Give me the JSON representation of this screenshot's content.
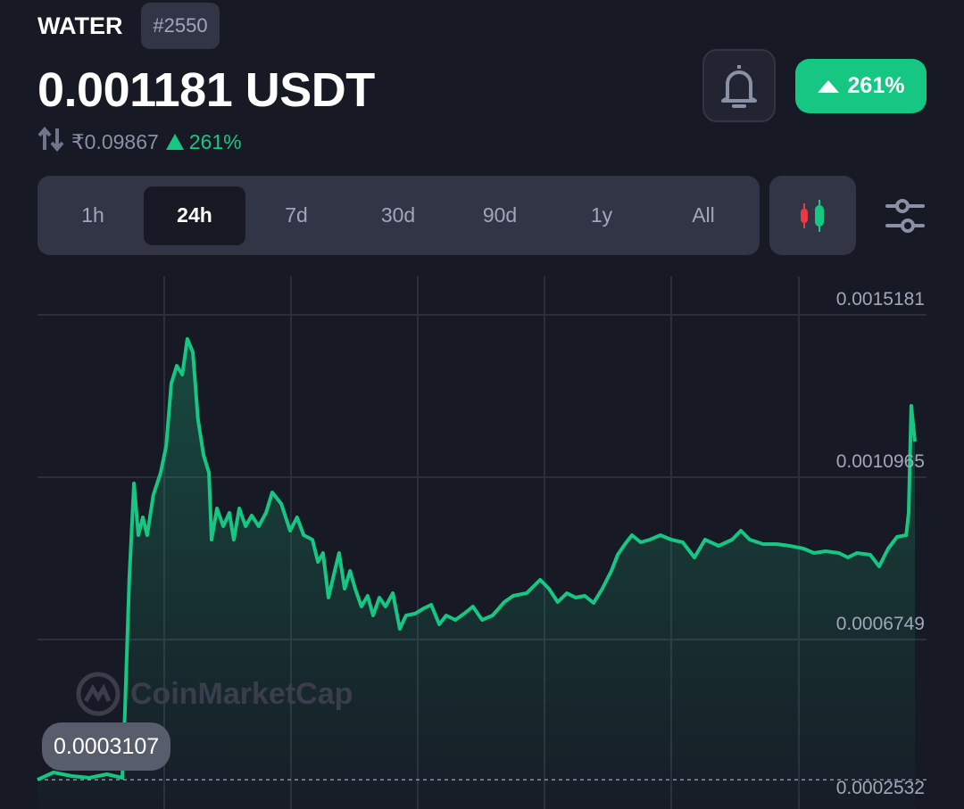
{
  "header": {
    "symbol": "WATER",
    "rank": "#2550",
    "price": "0.001181 USDT",
    "inr_price": "₹0.09867",
    "change": "261%",
    "badge_change": "261%"
  },
  "colors": {
    "up": "#16c784",
    "down": "#ea3943",
    "background": "#171924",
    "panel": "#323546"
  },
  "icons": {
    "swap": "swap-vertical-icon",
    "bell": "bell-icon",
    "candles": "candlestick-icon",
    "filter": "sliders-icon",
    "up": "triangle-up-icon"
  },
  "tabs": [
    {
      "label": "1h"
    },
    {
      "label": "24h",
      "active": true
    },
    {
      "label": "7d"
    },
    {
      "label": "30d"
    },
    {
      "label": "90d"
    },
    {
      "label": "1y"
    },
    {
      "label": "All"
    }
  ],
  "watermark": "CoinMarketCap",
  "chart_data": {
    "type": "area",
    "range": "24h",
    "grid": true,
    "y_ticks": [
      "0.0015181",
      "0.0010965",
      "0.0006749",
      "0.0002532"
    ],
    "open_price_label": "0.0003107",
    "open_price": 0.0003107,
    "xlim": [
      0,
      24
    ],
    "x_unit": "hours",
    "points": [
      [
        0,
        0.0003107
      ],
      [
        0.44,
        0.0003297
      ],
      [
        0.93,
        0.0003205
      ],
      [
        1.42,
        0.0003158
      ],
      [
        1.9,
        0.0003251
      ],
      [
        2.32,
        0.0003158
      ],
      [
        2.39,
        0.0004826
      ],
      [
        2.51,
        0.0008301
      ],
      [
        2.64,
        0.0010803
      ],
      [
        2.76,
        0.0009459
      ],
      [
        2.88,
        0.0009923
      ],
      [
        3.0,
        0.0009459
      ],
      [
        3.17,
        0.0010502
      ],
      [
        3.37,
        0.0011081
      ],
      [
        3.52,
        0.0011776
      ],
      [
        3.66,
        0.0013397
      ],
      [
        3.81,
        0.0013861
      ],
      [
        3.96,
        0.0013629
      ],
      [
        4.1,
        0.0014556
      ],
      [
        4.25,
        0.0014208
      ],
      [
        4.39,
        0.0012471
      ],
      [
        4.54,
        0.0011544
      ],
      [
        4.69,
        0.0011081
      ],
      [
        4.76,
        0.0009343
      ],
      [
        4.91,
        0.0010154
      ],
      [
        5.08,
        0.0009691
      ],
      [
        5.25,
        0.0010038
      ],
      [
        5.37,
        0.0009343
      ],
      [
        5.52,
        0.0010154
      ],
      [
        5.69,
        0.0009691
      ],
      [
        5.86,
        0.0009969
      ],
      [
        6.05,
        0.0009691
      ],
      [
        6.25,
        0.0010038
      ],
      [
        6.42,
        0.0010571
      ],
      [
        6.67,
        0.001027
      ],
      [
        6.91,
        0.0009575
      ],
      [
        7.1,
        0.0009923
      ],
      [
        7.28,
        0.0009459
      ],
      [
        7.52,
        0.0009343
      ],
      [
        7.67,
        0.0008764
      ],
      [
        7.81,
        0.0008996
      ],
      [
        7.96,
        0.0007838
      ],
      [
        8.13,
        0.0008533
      ],
      [
        8.25,
        0.0008996
      ],
      [
        8.4,
        0.0008069
      ],
      [
        8.55,
        0.0008533
      ],
      [
        8.69,
        0.0008069
      ],
      [
        8.86,
        0.0007606
      ],
      [
        9.03,
        0.0007884
      ],
      [
        9.18,
        0.0007374
      ],
      [
        9.35,
        0.0007838
      ],
      [
        9.52,
        0.0007606
      ],
      [
        9.72,
        0.0007954
      ],
      [
        9.91,
        0.0007027
      ],
      [
        10.08,
        0.0007374
      ],
      [
        10.33,
        0.0007421
      ],
      [
        10.57,
        0.000756
      ],
      [
        10.77,
        0.0007652
      ],
      [
        10.99,
        0.0007143
      ],
      [
        11.18,
        0.0007374
      ],
      [
        11.43,
        0.0007259
      ],
      [
        11.67,
        0.0007421
      ],
      [
        11.91,
        0.0007606
      ],
      [
        12.16,
        0.0007259
      ],
      [
        12.45,
        0.0007374
      ],
      [
        12.77,
        0.0007722
      ],
      [
        13.01,
        0.0007884
      ],
      [
        13.38,
        0.0007954
      ],
      [
        13.75,
        0.0008301
      ],
      [
        13.99,
        0.0008069
      ],
      [
        14.23,
        0.0007722
      ],
      [
        14.48,
        0.0007954
      ],
      [
        14.72,
        0.0007838
      ],
      [
        14.97,
        0.0007884
      ],
      [
        15.21,
        0.0007699
      ],
      [
        15.45,
        0.0008069
      ],
      [
        15.7,
        0.0008533
      ],
      [
        15.87,
        0.000895
      ],
      [
        16.07,
        0.0009228
      ],
      [
        16.26,
        0.0009459
      ],
      [
        16.5,
        0.0009274
      ],
      [
        16.75,
        0.0009343
      ],
      [
        17.04,
        0.0009459
      ],
      [
        17.33,
        0.0009343
      ],
      [
        17.65,
        0.0009274
      ],
      [
        17.97,
        0.000888
      ],
      [
        18.26,
        0.0009343
      ],
      [
        18.63,
        0.0009181
      ],
      [
        19.0,
        0.0009343
      ],
      [
        19.24,
        0.0009575
      ],
      [
        19.48,
        0.0009343
      ],
      [
        19.85,
        0.0009228
      ],
      [
        20.22,
        0.0009228
      ],
      [
        20.58,
        0.0009181
      ],
      [
        20.95,
        0.0009112
      ],
      [
        21.24,
        0.0008996
      ],
      [
        21.56,
        0.0009042
      ],
      [
        21.92,
        0.0008996
      ],
      [
        22.17,
        0.000888
      ],
      [
        22.41,
        0.0008996
      ],
      [
        22.78,
        0.000895
      ],
      [
        23.02,
        0.0008649
      ],
      [
        23.27,
        0.0009112
      ],
      [
        23.51,
        0.0009413
      ],
      [
        23.76,
        0.0009459
      ],
      [
        23.83,
        0.0010038
      ],
      [
        23.9,
        0.0012818
      ],
      [
        24.0,
        0.0011892
      ]
    ]
  }
}
